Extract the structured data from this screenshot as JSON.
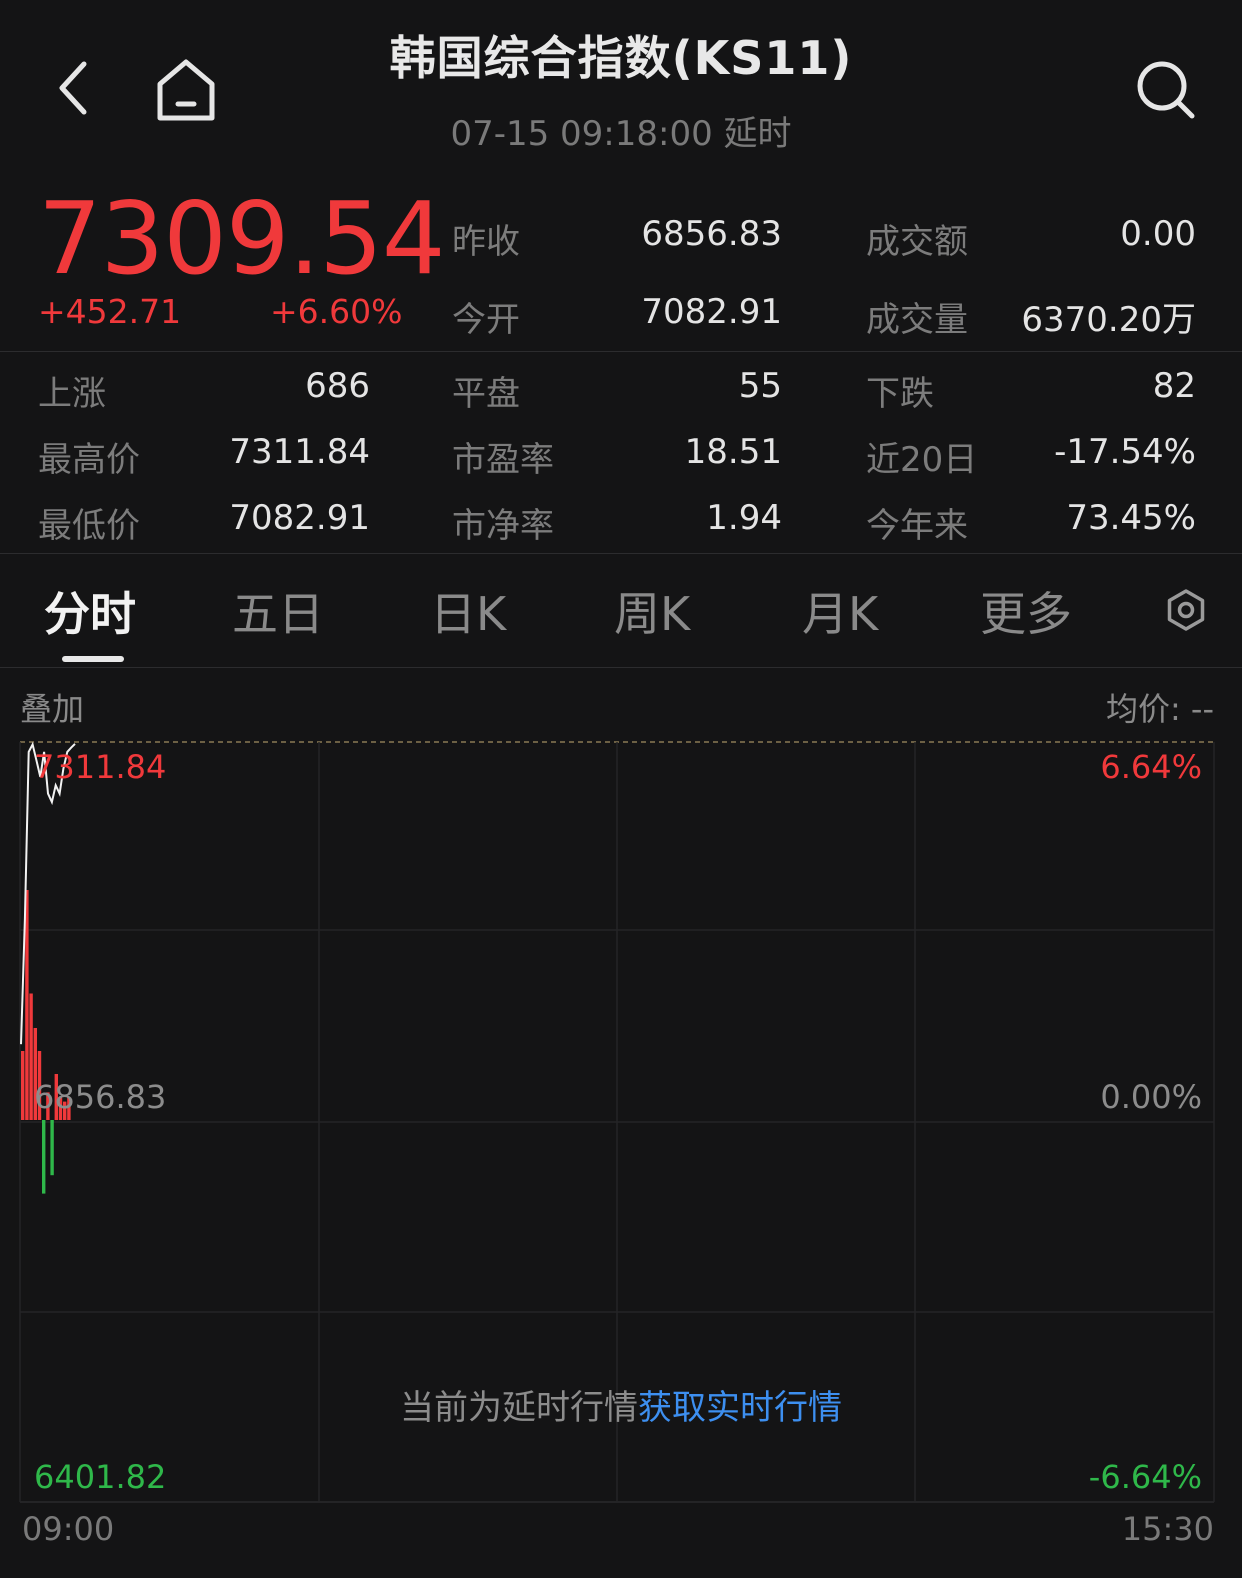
{
  "header": {
    "title": "韩国综合指数(KS11)",
    "subtitle": "07-15 09:18:00  延时",
    "back_icon": "chevron-left-icon",
    "home_icon": "home-icon",
    "search_icon": "search-icon"
  },
  "quote": {
    "price": "7309.54",
    "change": "+452.71",
    "change_pct": "+6.60%",
    "up_color": "#f0393b",
    "down_color": "#2fb84a"
  },
  "stats": [
    [
      {
        "label": "昨收",
        "value": "6856.83"
      },
      {
        "label": "成交额",
        "value": "0.00"
      }
    ],
    [
      {
        "label": "今开",
        "value": "7082.91"
      },
      {
        "label": "成交量",
        "value": "6370.20万"
      }
    ]
  ],
  "breadth": [
    [
      {
        "label": "上涨",
        "value": "686"
      },
      {
        "label": "平盘",
        "value": "55"
      },
      {
        "label": "下跌",
        "value": "82"
      }
    ],
    [
      {
        "label": "最高价",
        "value": "7311.84"
      },
      {
        "label": "市盈率",
        "value": "18.51"
      },
      {
        "label": "近20日",
        "value": "-17.54%"
      }
    ],
    [
      {
        "label": "最低价",
        "value": "7082.91"
      },
      {
        "label": "市净率",
        "value": "1.94"
      },
      {
        "label": "今年来",
        "value": "73.45%"
      }
    ]
  ],
  "tabs": [
    "分时",
    "五日",
    "日K",
    "周K",
    "月K",
    "更多"
  ],
  "active_tab": "分时",
  "settings_icon": "settings-icon",
  "chart": {
    "overlay_label": "叠加",
    "avg_label": "均价: --",
    "top_price": "7311.84",
    "top_pct": "6.64%",
    "mid_price": "6856.83",
    "mid_pct": "0.00%",
    "bottom_price": "6401.82",
    "bottom_pct": "-6.64%",
    "start_time": "09:00",
    "end_time": "15:30",
    "notice": "当前为延时行情",
    "notice_link": "获取实时行情"
  },
  "chart_data": {
    "type": "line",
    "x_range": [
      "09:00",
      "15:30"
    ],
    "ylim": [
      6401.82,
      7311.84
    ],
    "prev_close": 6856.83,
    "price_points": [
      6950,
      7100,
      7300,
      7309,
      7290,
      7270,
      7300,
      7250,
      7240,
      7260,
      7250,
      7280,
      7300,
      7305,
      7309.54
    ],
    "volume_bars": [
      0.3,
      1.0,
      0.55,
      0.4,
      0.3,
      0.2,
      0.12,
      0.15,
      0.2,
      0.1,
      0.08,
      0.1
    ],
    "volume_dirs": [
      "up",
      "up",
      "up",
      "up",
      "up",
      "down",
      "up",
      "down",
      "up",
      "up",
      "up",
      "up"
    ]
  }
}
